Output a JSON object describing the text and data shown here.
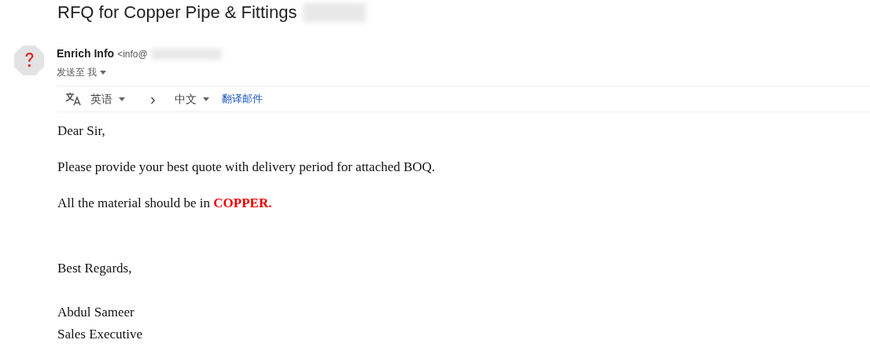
{
  "subject": "RFQ for Copper Pipe & Fittings",
  "sender": {
    "name": "Enrich Info",
    "address": "<info@",
    "recipient": "发送至 我"
  },
  "translate_bar": {
    "source_language": "英语",
    "arrow": "›",
    "target_language": "中文",
    "action": "翻译邮件"
  },
  "body": [
    {
      "kind": "para",
      "text": "Dear Sir,"
    },
    {
      "kind": "para",
      "text": "Please provide your best quote with delivery period for attached BOQ."
    },
    {
      "kind": "para",
      "text": "All the material should be in **COPPER.**"
    },
    {
      "kind": "gap"
    },
    {
      "kind": "para",
      "text": "Best Regards,"
    },
    {
      "kind": "gap_small"
    },
    {
      "kind": "line",
      "text": "Abdul Sameer"
    },
    {
      "kind": "line",
      "text": "Sales Executive"
    }
  ]
}
